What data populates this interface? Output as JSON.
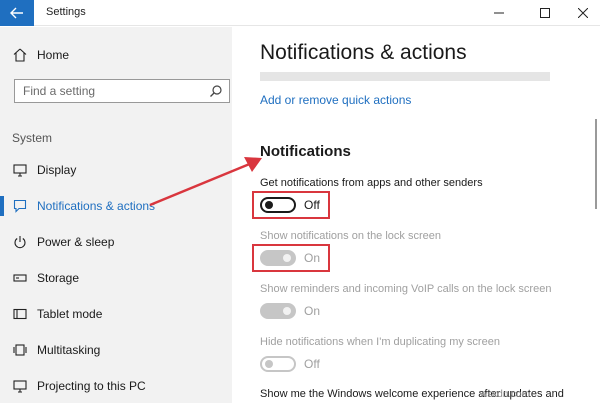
{
  "window": {
    "title": "Settings",
    "controls": [
      "minimize-icon",
      "maximize-icon",
      "close-icon"
    ]
  },
  "sidebar": {
    "home_label": "Home",
    "search_placeholder": "Find a setting",
    "section_label": "System",
    "items": [
      {
        "label": "Display",
        "icon": "monitor-icon"
      },
      {
        "label": "Notifications & actions",
        "icon": "notification-icon",
        "active": true
      },
      {
        "label": "Power & sleep",
        "icon": "power-icon"
      },
      {
        "label": "Storage",
        "icon": "storage-icon"
      },
      {
        "label": "Tablet mode",
        "icon": "tablet-icon"
      },
      {
        "label": "Multitasking",
        "icon": "multitasking-icon"
      },
      {
        "label": "Projecting to this PC",
        "icon": "projecting-icon"
      }
    ]
  },
  "main": {
    "title": "Notifications & actions",
    "quick_actions_link": "Add or remove quick actions",
    "section_heading": "Notifications",
    "settings": [
      {
        "label": "Get notifications from apps and other senders",
        "state": "Off",
        "enabled": true
      },
      {
        "label": "Show notifications on the lock screen",
        "state": "On",
        "enabled": false
      },
      {
        "label": "Show reminders and incoming VoIP calls on the lock screen",
        "state": "On",
        "enabled": false
      },
      {
        "label": "Hide notifications when I'm duplicating my screen",
        "state": "Off",
        "enabled": false
      },
      {
        "label": "Show me the Windows welcome experience after updates and",
        "state": "",
        "enabled": true
      }
    ]
  },
  "watermark": "wsxdn.com",
  "colors": {
    "accent": "#1f6fc0",
    "highlight": "#d9363e",
    "sidebar_bg": "#f2f2f2",
    "disabled_text": "#a0a0a0"
  }
}
